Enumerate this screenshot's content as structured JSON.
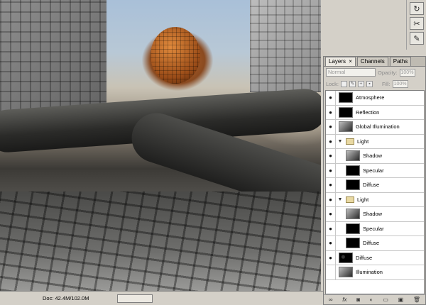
{
  "panel": {
    "tabs": [
      {
        "label": "Layers",
        "close": "×"
      },
      {
        "label": "Channels"
      },
      {
        "label": "Paths"
      }
    ],
    "blend_mode": "Normal",
    "opacity_label": "Opacity:",
    "opacity_value": "100%",
    "lock_label": "Lock:",
    "fill_label": "Fill:",
    "fill_value": "100%",
    "layers": [
      {
        "name": "Atmosphere",
        "visible": true,
        "type": "layer",
        "thumb": "black"
      },
      {
        "name": "Reflection",
        "visible": true,
        "type": "layer",
        "thumb": "black"
      },
      {
        "name": "Global Illumination",
        "visible": true,
        "type": "layer",
        "thumb": "image"
      },
      {
        "name": "Light",
        "visible": true,
        "type": "group"
      },
      {
        "name": "Shadow",
        "visible": true,
        "type": "layer",
        "thumb": "image",
        "indent": true
      },
      {
        "name": "Specular",
        "visible": true,
        "type": "layer",
        "thumb": "black",
        "indent": true
      },
      {
        "name": "Diffuse",
        "visible": true,
        "type": "layer",
        "thumb": "black",
        "indent": true
      },
      {
        "name": "Light",
        "visible": true,
        "type": "group"
      },
      {
        "name": "Shadow",
        "visible": true,
        "type": "layer",
        "thumb": "image",
        "indent": true
      },
      {
        "name": "Specular",
        "visible": true,
        "type": "layer",
        "thumb": "black",
        "indent": true
      },
      {
        "name": "Diffuse",
        "visible": true,
        "type": "layer",
        "thumb": "black",
        "indent": true
      },
      {
        "name": "Diffuse",
        "visible": true,
        "type": "layer",
        "thumb": "spots"
      },
      {
        "name": "Illumination",
        "visible": false,
        "type": "layer",
        "thumb": "image"
      }
    ],
    "bottom_icons": [
      "link-icon",
      "fx-icon",
      "mask-icon",
      "adjustment-icon",
      "group-icon",
      "new-layer-icon",
      "trash-icon"
    ]
  },
  "status": {
    "doc_label": "Doc: 42.4M/102.0M"
  },
  "colors": {
    "panel_bg": "#d4d0c8",
    "layers_bg": "#ffffff"
  }
}
